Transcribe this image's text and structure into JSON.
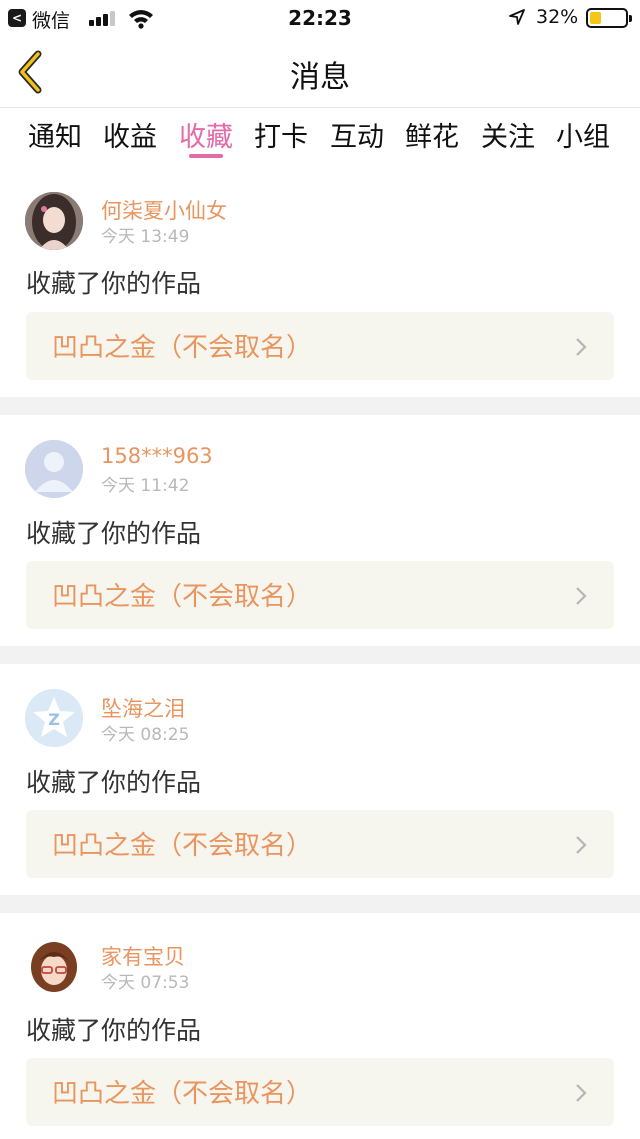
{
  "status_bar": {
    "back_app": "微信",
    "time": "22:23",
    "battery_percent": "32%",
    "battery_level": 0.32,
    "back_icon": "back-arrow-icon",
    "signal_icon": "cell-signal-icon",
    "wifi_icon": "wifi-icon",
    "location_icon": "location-arrow-icon",
    "battery_icon": "battery-icon"
  },
  "navbar": {
    "title": "消息",
    "back_icon": "chevron-left-icon",
    "accent_color": "#f2c21a"
  },
  "tabs": [
    {
      "label": "通知",
      "active": false
    },
    {
      "label": "收益",
      "active": false
    },
    {
      "label": "收藏",
      "active": true
    },
    {
      "label": "打卡",
      "active": false
    },
    {
      "label": "互动",
      "active": false
    },
    {
      "label": "鲜花",
      "active": false
    },
    {
      "label": "关注",
      "active": false
    },
    {
      "label": "小组",
      "active": false
    }
  ],
  "active_tab_color": "#e46aa8",
  "name_color": "#e9955f",
  "messages": [
    {
      "user": "何柒夏小仙女",
      "time": "今天 13:49",
      "action": "收藏了你的作品",
      "work": "凹凸之金（不会取名）",
      "avatar": "girl-portrait-avatar"
    },
    {
      "user": "158***963",
      "time": "今天 11:42",
      "action": "收藏了你的作品",
      "work": "凹凸之金（不会取名）",
      "avatar": "default-user-avatar"
    },
    {
      "user": "坠海之泪",
      "time": "今天 08:25",
      "action": "收藏了你的作品",
      "work": "凹凸之金（不会取名）",
      "avatar": "qzone-star-avatar"
    },
    {
      "user": "家有宝贝",
      "time": "今天 07:53",
      "action": "收藏了你的作品",
      "work": "凹凸之金（不会取名）",
      "avatar": "cartoon-girl-avatar"
    }
  ]
}
